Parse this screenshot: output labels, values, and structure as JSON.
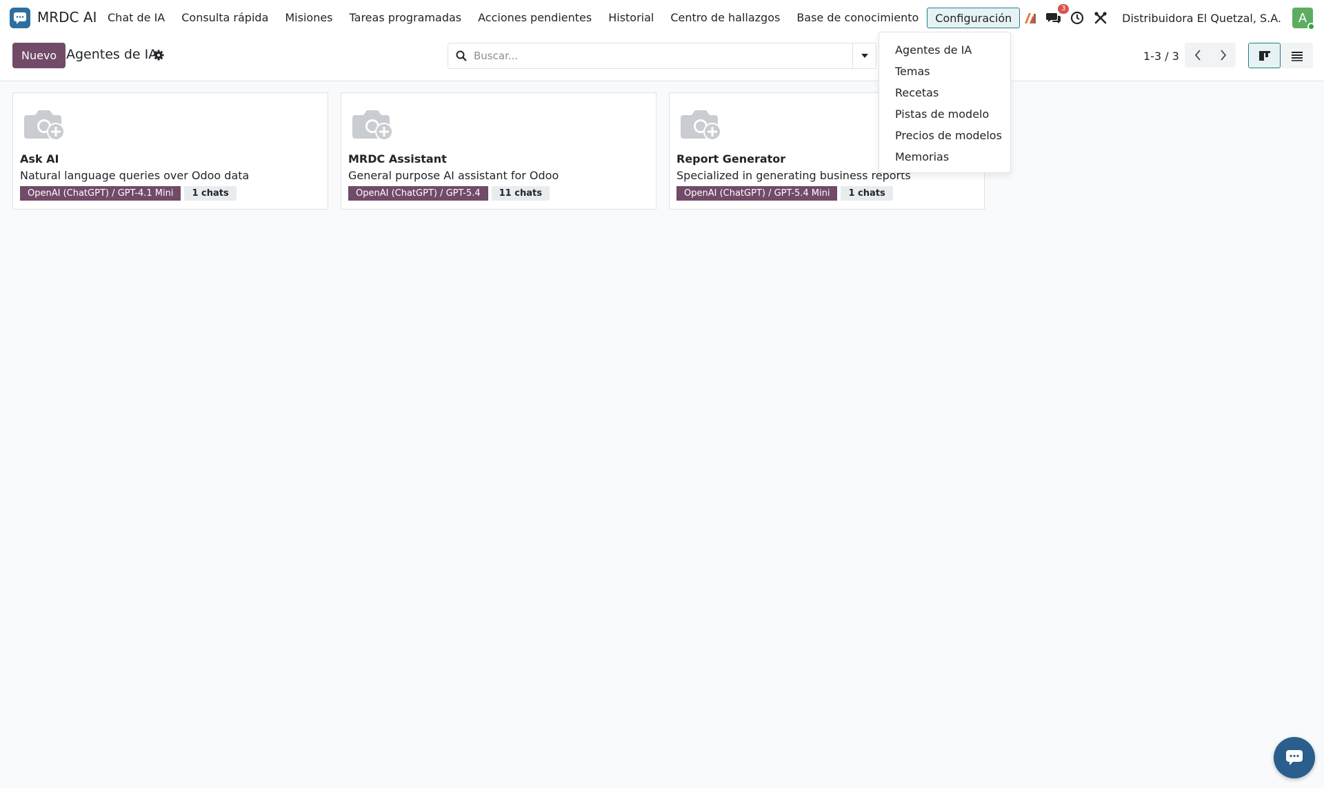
{
  "app": {
    "name": "MRDC AI"
  },
  "menu": [
    {
      "label": "Chat de IA"
    },
    {
      "label": "Consulta rápida"
    },
    {
      "label": "Misiones"
    },
    {
      "label": "Tareas programadas"
    },
    {
      "label": "Acciones pendientes"
    },
    {
      "label": "Historial"
    },
    {
      "label": "Centro de hallazgos"
    },
    {
      "label": "Base de conocimiento"
    },
    {
      "label": "Configuración"
    }
  ],
  "systray": {
    "chat_badge": "3",
    "company": "Distribuidora El Quetzal, S.A.",
    "avatar_initial": "A"
  },
  "control": {
    "new_label": "Nuevo",
    "title": "Agentes de IA",
    "search_placeholder": "Buscar...",
    "pager": "1-3 / 3"
  },
  "cards": [
    {
      "title": "Ask AI",
      "description": "Natural language queries over Odoo data",
      "model": "OpenAI (ChatGPT) / GPT-4.1 Mini",
      "chats": "1 chats"
    },
    {
      "title": "MRDC Assistant",
      "description": "General purpose AI assistant for Odoo",
      "model": "OpenAI (ChatGPT) / GPT-5.4",
      "chats": "11 chats"
    },
    {
      "title": "Report Generator",
      "description": "Specialized in generating business reports",
      "model": "OpenAI (ChatGPT) / GPT-5.4 Mini",
      "chats": "1 chats"
    }
  ],
  "dropdown": [
    {
      "label": "Agentes de IA"
    },
    {
      "label": "Temas"
    },
    {
      "label": "Recetas"
    },
    {
      "label": "Pistas de modelo"
    },
    {
      "label": "Precios de modelos"
    },
    {
      "label": "Memorias"
    }
  ],
  "colors": {
    "primary": "#714b67",
    "accent": "#217a8a",
    "app_icon": "#2f6f9f"
  }
}
